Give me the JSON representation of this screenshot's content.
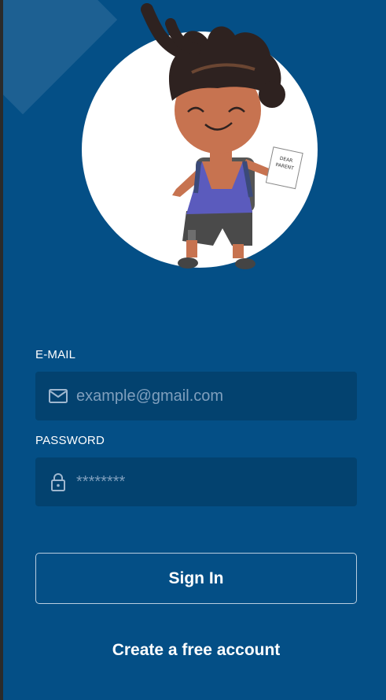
{
  "hero": {
    "illustration": "boy-holding-dear-parent-note",
    "note_text": "DEAR PARENT"
  },
  "form": {
    "email_label": "E-MAIL",
    "email_placeholder": "example@gmail.com",
    "email_icon": "envelope-icon",
    "password_label": "PASSWORD",
    "password_placeholder": "********",
    "password_icon": "lock-icon"
  },
  "actions": {
    "sign_in_label": "Sign In",
    "create_account_label": "Create a free account"
  },
  "colors": {
    "background": "#044f86",
    "field_background": "#03426f",
    "text": "#ffffff",
    "placeholder": "#7f9fbd"
  }
}
